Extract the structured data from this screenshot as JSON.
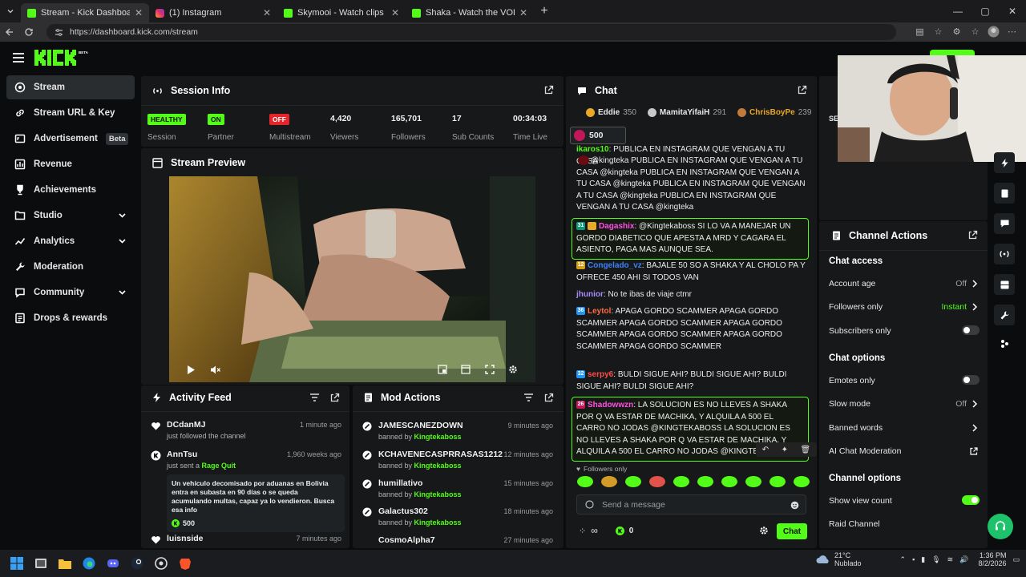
{
  "browser": {
    "tabs": [
      {
        "label": "Stream - Kick Dashboard",
        "active": true
      },
      {
        "label": "(1) Instagram",
        "active": false
      },
      {
        "label": "Skymooi - Watch clips on Kick",
        "active": false
      },
      {
        "label": "Shaka - Watch the VOD on Kick",
        "active": false
      }
    ],
    "url": "https://dashboard.kick.com/stream"
  },
  "brand": {
    "logo": "KICK",
    "beta": "BETA",
    "accent": "#53fc18"
  },
  "sidebar": {
    "items": [
      {
        "label": "Stream",
        "icon": "broadcast-icon",
        "active": true
      },
      {
        "label": "Stream URL & Key",
        "icon": "link-icon"
      },
      {
        "label": "Advertisement",
        "icon": "ad-icon",
        "badge": "Beta"
      },
      {
        "label": "Revenue",
        "icon": "chart-icon"
      },
      {
        "label": "Achievements",
        "icon": "trophy-icon"
      },
      {
        "label": "Studio",
        "icon": "studio-icon",
        "expandable": true
      },
      {
        "label": "Analytics",
        "icon": "analytics-icon",
        "expandable": true
      },
      {
        "label": "Moderation",
        "icon": "wrench-icon"
      },
      {
        "label": "Community",
        "icon": "community-icon",
        "expandable": true
      },
      {
        "label": "Drops & rewards",
        "icon": "gift-icon"
      }
    ]
  },
  "session": {
    "title": "Session Info",
    "stats": [
      {
        "value": "HEALTHY",
        "label": "Session",
        "kind": "pill-green"
      },
      {
        "value": "ON",
        "label": "Partner",
        "kind": "pill-green"
      },
      {
        "value": "OFF",
        "label": "Multistream",
        "kind": "pill-red"
      },
      {
        "value": "4,420",
        "label": "Viewers"
      },
      {
        "value": "165,701",
        "label": "Followers"
      },
      {
        "value": "17",
        "label": "Sub Counts"
      },
      {
        "value": "00:34:03",
        "label": "Time Live"
      }
    ]
  },
  "preview": {
    "title": "Stream Preview"
  },
  "activity": {
    "title": "Activity Feed",
    "items": [
      {
        "name": "DCdanMJ",
        "desc": "just followed the channel",
        "time": "1 minute ago",
        "icon": "heart-icon"
      },
      {
        "name": "AnnTsu",
        "desc": "just sent a ",
        "desc_link": "Rage Quit",
        "time": "1,960 weeks ago",
        "icon": "kick-icon",
        "message": "Un vehículo decomisado por aduanas en Bolivia entra en subasta en 90 días o se queda acumulando multas, capaz ya lo vendieron. Busca esa info",
        "amount": "500"
      },
      {
        "name": "luisnside",
        "desc": "",
        "time": "7 minutes ago",
        "icon": "heart-icon"
      }
    ]
  },
  "mod": {
    "title": "Mod Actions",
    "prefix": "banned by ",
    "items": [
      {
        "name": "JAMESCANEZDOWN",
        "by": "Kingtekaboss",
        "time": "9 minutes ago"
      },
      {
        "name": "KCHAVENECASPRRASAS1212",
        "by": "Kingtekaboss",
        "time": "12 minutes ago"
      },
      {
        "name": "humillativo",
        "by": "Kingtekaboss",
        "time": "15 minutes ago"
      },
      {
        "name": "Galactus302",
        "by": "Kingtekaboss",
        "time": "18 minutes ago"
      },
      {
        "name": "CosmoAlpha7",
        "by": "",
        "time": "27 minutes ago"
      }
    ]
  },
  "chat": {
    "title": "Chat",
    "top": [
      {
        "name": "Eddie",
        "score": "350"
      },
      {
        "name": "MamitaYifaiH",
        "score": "291"
      },
      {
        "name": "ChrisBoyPe",
        "score": "239"
      }
    ],
    "pinned_amount": "500",
    "messages": [
      {
        "user": "ikaros10",
        "color": "#53fc18",
        "badge": "",
        "text": "PUBLICA EN INSTAGRAM QUE VENGAN A TU CASA"
      },
      {
        "user": "",
        "text": "@kingteka PUBLICA EN INSTAGRAM QUE VENGAN A TU CASA @kingteka PUBLICA EN INSTAGRAM QUE VENGAN A TU CASA @kingteka PUBLICA EN INSTAGRAM QUE VENGAN A TU CASA @kingteka PUBLICA EN INSTAGRAM QUE VENGAN A TU CASA @kingteka"
      },
      {
        "user": "Dagashix",
        "color": "#ff4fe8",
        "badge": "31",
        "text": "@Kingtekaboss SI LO VA A MANEJAR UN GORDO DIABETICO QUE APESTA A MRD Y CAGARA EL ASIENTO, PAGA MAS AUNQUE SEA."
      },
      {
        "user": "Congelado_vz",
        "color": "#3b82f6",
        "badge": "12",
        "text": "BAJALE 50 SO A SHAKA Y AL CHOLO PA Y OFRECE 450 AHI SI TODOS VAN"
      },
      {
        "user": "jhunior",
        "color": "#a78bfa",
        "badge": "",
        "text": "No te ibas de viaje ctmr"
      },
      {
        "user": "Leytol",
        "color": "#ff6a3d",
        "badge": "36",
        "text": "APAGA GORDO SCAMMER APAGA GORDO SCAMMER APAGA GORDO SCAMMER APAGA GORDO SCAMMER APAGA GORDO SCAMMER APAGA GORDO SCAMMER APAGA GORDO SCAMMER"
      },
      {
        "user": "serpy6",
        "color": "#ff4d4d",
        "badge": "32",
        "text": "BULDI SIGUE AHI? BULDI SIGUE AHI? BULDI SIGUE AHI? BULDI SIGUE AHI?"
      },
      {
        "user": "Shadowwzn",
        "color": "#ff4fe8",
        "badge": "26",
        "text": "LA SOLUCION ES NO LLEVES A SHAKA POR Q VA ESTAR DE MACHIKA, Y ALQUILA A 500 EL CARRO NO JODAS @KINGTEKABOSS LA SOLUCION ES NO LLEVES A SHAKA POR Q VA ESTAR DE MACHIKA, Y ALQUILA A 500 EL CARRO NO JODAS @KINGTEKABOSS"
      }
    ],
    "followers_only": "Followers only",
    "input_placeholder": "Send a message",
    "send_label": "Chat",
    "points": "0"
  },
  "channel_actions": {
    "title": "Channel Actions",
    "access_heading": "Chat access",
    "account_age": {
      "label": "Account age",
      "value": "Off"
    },
    "followers_only": {
      "label": "Followers only",
      "value": "Instant"
    },
    "subscribers_only": {
      "label": "Subscribers only"
    },
    "options_heading": "Chat options",
    "emotes_only": {
      "label": "Emotes only"
    },
    "slow_mode": {
      "label": "Slow mode",
      "value": "Off"
    },
    "banned_words": {
      "label": "Banned words"
    },
    "ai_moderation": {
      "label": "AI Chat Moderation"
    },
    "channel_heading": "Channel options",
    "view_count": {
      "label": "Show view count"
    },
    "raid": {
      "label": "Raid Channel"
    },
    "se_label": "SE"
  },
  "taskbar": {
    "weather_temp": "21°C",
    "weather_desc": "Nublado",
    "time": "1:36 PM",
    "date": "8/2/2026"
  }
}
